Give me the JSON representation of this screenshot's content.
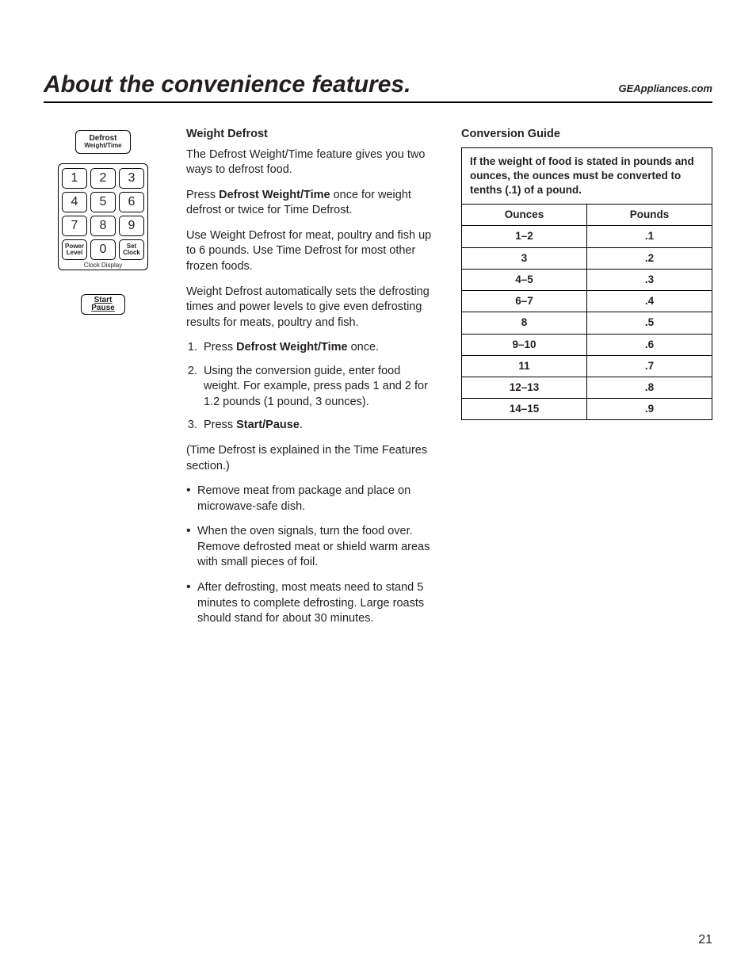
{
  "header": {
    "title": "About the convenience features.",
    "site": "GEAppliances.com"
  },
  "sidebar": {
    "defrost": {
      "line1": "Defrost",
      "line2": "Weight/Time"
    },
    "keys": [
      "1",
      "2",
      "3",
      "4",
      "5",
      "6",
      "7",
      "8",
      "9"
    ],
    "powerLevel": {
      "l1": "Power",
      "l2": "Level"
    },
    "zero": "0",
    "setClock": {
      "l1": "Set",
      "l2": "Clock"
    },
    "clockDisplay": "Clock Display",
    "start": {
      "l1": "Start",
      "l2": "Pause"
    }
  },
  "left": {
    "h": "Weight Defrost",
    "p1": "The Defrost Weight/Time feature gives you two ways to defrost food.",
    "p2a": "Press ",
    "p2b": "Defrost Weight/Time",
    "p2c": " once for weight defrost or twice for Time Defrost.",
    "p3": "Use Weight Defrost for meat, poultry and fish up to 6 pounds.  Use Time Defrost for most other frozen foods.",
    "p4": "Weight Defrost automatically sets the defrosting times and power levels to give even defrosting results for meats, poultry and fish.",
    "ol1a": "Press ",
    "ol1b": "Defrost Weight/Time",
    "ol1c": " once.",
    "ol2": "Using the conversion guide, enter food weight. For example, press pads 1 and 2 for 1.2 pounds (1 pound, 3 ounces).",
    "ol3a": "Press ",
    "ol3b": "Start/Pause",
    "ol3c": ".",
    "p5": "(Time Defrost is explained in the Time Features section.)",
    "b1": "Remove meat from package and place on microwave-safe dish.",
    "b2": "When the oven signals, turn the food over. Remove defrosted meat or shield warm areas with small pieces of foil.",
    "b3": "After defrosting, most meats need to stand 5 minutes to complete defrosting. Large roasts should stand for about 30 minutes."
  },
  "right": {
    "h": "Conversion Guide",
    "caption": "If the weight of food is stated in pounds and ounces, the ounces must be converted to tenths (.1) of a pound.",
    "th1": "Ounces",
    "th2": "Pounds",
    "rows": [
      {
        "o": "1–2",
        "p": ".1"
      },
      {
        "o": "3",
        "p": ".2"
      },
      {
        "o": "4–5",
        "p": ".3"
      },
      {
        "o": "6–7",
        "p": ".4"
      },
      {
        "o": "8",
        "p": ".5"
      },
      {
        "o": "9–10",
        "p": ".6"
      },
      {
        "o": "11",
        "p": ".7"
      },
      {
        "o": "12–13",
        "p": ".8"
      },
      {
        "o": "14–15",
        "p": ".9"
      }
    ]
  },
  "pageNum": "21"
}
